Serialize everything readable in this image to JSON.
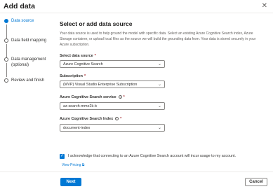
{
  "dialog": {
    "title": "Add data",
    "close_glyph": "✕"
  },
  "steps": [
    {
      "label": "Data source",
      "active": true
    },
    {
      "label": "Data field mapping",
      "active": false
    },
    {
      "label": "Data management",
      "sublabel": "(optional)",
      "active": false
    },
    {
      "label": "Review and finish",
      "active": false
    }
  ],
  "main": {
    "title": "Select or add data source",
    "description": "Your data source is used to help ground the model with specific data. Select an existing Azure Cognitive Search index, Azure Storage container, or upload local files as the source we will build the grounding data from. Your data is stored securely in your Azure subscription."
  },
  "fields": {
    "data_source": {
      "label": "Select data source",
      "required": "*",
      "value": "Azure Cognitive Search"
    },
    "subscription": {
      "label": "Subscription",
      "required": "*",
      "value": "(MVP) Visual Studio Enterprise Subscription"
    },
    "search_service": {
      "label": "Azure Cognitive Search service",
      "required": "*",
      "value": "az-search-mme2k-b"
    },
    "search_index": {
      "label": "Azure Cognitive Search Index",
      "required": "*",
      "value": "document-index"
    }
  },
  "acknowledge": {
    "checked_glyph": "✓",
    "text": "I acknowledge that connecting to an Azure Cognitive Search account will incur usage to my account.",
    "pricing_link": "View Pricing ⧉"
  },
  "footer": {
    "next_label": "Next",
    "cancel_label": "Cancel"
  },
  "colors": {
    "accent": "#0078d4",
    "required": "#a4262c"
  }
}
